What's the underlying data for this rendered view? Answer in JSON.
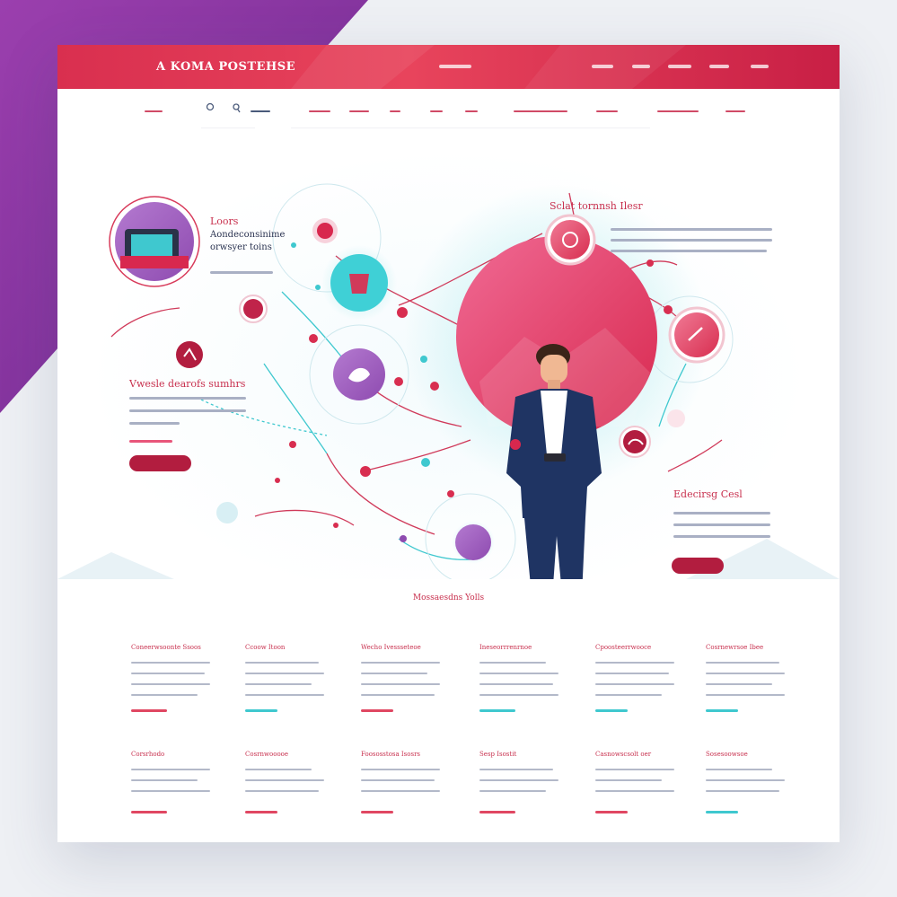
{
  "header": {
    "brand": "A KOMA POSTEHSE",
    "nav": [
      "",
      "",
      "",
      "",
      "",
      ""
    ]
  },
  "subnav": {
    "items": [
      "",
      "",
      "",
      "",
      "",
      "",
      "",
      "",
      "",
      ""
    ]
  },
  "hero": {
    "left_top_title": "Loors",
    "left_top_subtitle_1": "Aondeconsinime",
    "left_top_subtitle_2": "orwsyer toins",
    "left_mid_heading": "Vwesle dearofs sumhrs",
    "left_button": "",
    "right_top_heading": "Sclat tornnsh Ilesr",
    "right_bottom_heading": "Edecirsg Cesl",
    "right_button": ""
  },
  "features": {
    "title": "Mossaesdns Yolls",
    "cards": [
      {
        "title": "Coneerwsoonte Ssoos",
        "bar_color": "#e04762"
      },
      {
        "title": "Ccoow Itoon",
        "bar_color": "#3fc8cf"
      },
      {
        "title": "Wecho Ivessseteoe",
        "bar_color": "#e04762"
      },
      {
        "title": "Ineseorrrenrnoe",
        "bar_color": "#3fc8cf"
      },
      {
        "title": "Cpoosteerrwooce",
        "bar_color": "#3fc8cf"
      },
      {
        "title": "Cosrnewrsoe Ibee",
        "bar_color": "#3fc8cf"
      },
      {
        "title": "Corsrhodo",
        "bar_color": "#e04762"
      },
      {
        "title": "Cosrnwooooe",
        "bar_color": "#e04762"
      },
      {
        "title": "Foososstosa Isosrs",
        "bar_color": "#e04762"
      },
      {
        "title": "Sesp Isostit",
        "bar_color": "#e04762"
      },
      {
        "title": "Casnowscsolt oer",
        "bar_color": "#e04762"
      },
      {
        "title": "Sosesoowsoe",
        "bar_color": "#3fc8cf"
      }
    ]
  },
  "colors": {
    "primary": "#d92f4f",
    "accent_teal": "#3fc8cf",
    "accent_purple": "#8e4bb0",
    "navy": "#1f3463"
  },
  "icons": [
    "search-icon",
    "user-icon",
    "cart-icon",
    "gift-icon",
    "chart-icon",
    "heart-icon",
    "chat-icon"
  ]
}
